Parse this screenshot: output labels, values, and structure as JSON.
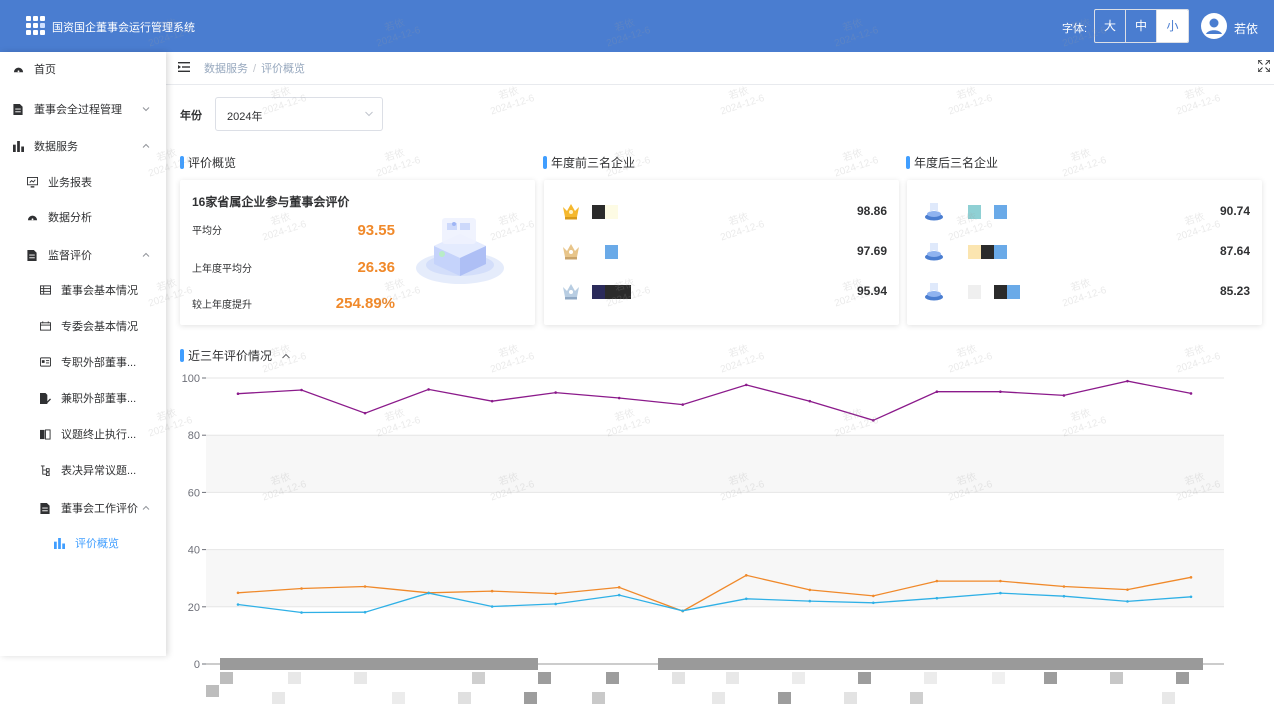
{
  "header": {
    "app_title": "国资国企董事会运行管理系统",
    "font_label": "字体:",
    "font_sizes": [
      "大",
      "中",
      "小"
    ],
    "active_font": "小",
    "username": "若依",
    "bg_color": "#4a7dd0"
  },
  "sidebar": {
    "items": [
      {
        "label": "首页",
        "icon": "dashboard-icon",
        "arrow": ""
      },
      {
        "label": "董事会全过程管理",
        "icon": "document-icon",
        "arrow": "down"
      },
      {
        "label": "数据服务",
        "icon": "bar-chart-icon",
        "arrow": "up"
      },
      {
        "label": "业务报表",
        "icon": "monitor-icon",
        "arrow": ""
      },
      {
        "label": "数据分析",
        "icon": "dashboard-icon",
        "arrow": ""
      },
      {
        "label": "监督评价",
        "icon": "document-icon",
        "arrow": "up"
      },
      {
        "label": "董事会基本情况",
        "icon": "table-icon",
        "arrow": ""
      },
      {
        "label": "专委会基本情况",
        "icon": "calendar-icon",
        "arrow": ""
      },
      {
        "label": "专职外部董事...",
        "icon": "card-icon",
        "arrow": ""
      },
      {
        "label": "兼职外部董事...",
        "icon": "file-edit-icon",
        "arrow": ""
      },
      {
        "label": "议题终止执行...",
        "icon": "book-icon",
        "arrow": ""
      },
      {
        "label": "表决异常议题...",
        "icon": "tree-icon",
        "arrow": ""
      },
      {
        "label": "董事会工作评价",
        "icon": "document-icon",
        "arrow": "up"
      },
      {
        "label": "评价概览",
        "icon": "bar-chart-icon",
        "arrow": ""
      }
    ]
  },
  "breadcrumb": [
    "数据服务",
    "评价概览"
  ],
  "filter": {
    "year_label": "年份",
    "year_value": "2024年"
  },
  "overview": {
    "title": "评价概览",
    "card_title": "16家省属企业参与董事会评价",
    "rows": [
      {
        "label": "平均分",
        "value": "93.55"
      },
      {
        "label": "上年度平均分",
        "value": "26.36"
      },
      {
        "label": "较上年度提升",
        "value": "254.89%"
      }
    ],
    "value_color": "#f0892a"
  },
  "top3": {
    "title": "年度前三名企业",
    "items": [
      {
        "score": "98.86",
        "icon": "gold-crown-icon",
        "blocks": [
          "#2b2b2b",
          "#fdfbe4"
        ]
      },
      {
        "score": "97.69",
        "icon": "silver-crown-icon",
        "blocks": [
          "#ffffff",
          "#6aaae8"
        ]
      },
      {
        "score": "95.94",
        "icon": "bronze-crown-icon",
        "blocks": [
          "#2b2b5b",
          "#2b2b2b",
          "#2b2b2b"
        ]
      }
    ]
  },
  "bottom3": {
    "title": "年度后三名企业",
    "items": [
      {
        "score": "90.74",
        "icon": "rank-14-icon",
        "blocks": [
          "#ffffff",
          "#8fd0d4",
          "#ffffff",
          "#6aaae8"
        ]
      },
      {
        "score": "87.64",
        "icon": "rank-15-icon",
        "blocks": [
          "#ffffff",
          "#fbe5b0",
          "#2b2b2b",
          "#6aaae8"
        ]
      },
      {
        "score": "85.23",
        "icon": "rank-16-icon",
        "blocks": [
          "#ffffff",
          "#efefef",
          "#ffffff",
          "#2b2b2b",
          "#6aaae8"
        ]
      }
    ]
  },
  "chart_section": {
    "title": "近三年评价情况"
  },
  "watermark": {
    "name": "若依",
    "date": "2024-12-6"
  },
  "chart_data": {
    "type": "line",
    "ylim": [
      0,
      100
    ],
    "yticks": [
      0,
      20,
      40,
      60,
      80,
      100
    ],
    "grid": true,
    "categories": [
      "",
      "",
      "",
      "",
      "",
      "",
      "",
      "",
      "",
      "",
      "",
      "",
      "",
      "",
      "",
      ""
    ],
    "series": [
      {
        "values": [
          94.5,
          95.8,
          87.7,
          96.0,
          91.9,
          94.9,
          93.0,
          90.7,
          97.6,
          91.9,
          85.2,
          95.2,
          95.2,
          93.9,
          98.9,
          94.6
        ],
        "color": "#8b1a8b"
      },
      {
        "values": [
          24.9,
          26.4,
          27.1,
          24.9,
          25.5,
          24.6,
          26.8,
          18.5,
          31.0,
          25.9,
          23.8,
          29.0,
          29.0,
          27.1,
          26.0,
          30.3
        ],
        "color": "#f0892a"
      },
      {
        "values": [
          20.8,
          18.0,
          18.1,
          24.8,
          20.1,
          21.0,
          24.1,
          18.6,
          22.8,
          22.0,
          21.4,
          23.0,
          24.8,
          23.7,
          21.9,
          23.5
        ],
        "color": "#2fb0e6"
      }
    ]
  }
}
